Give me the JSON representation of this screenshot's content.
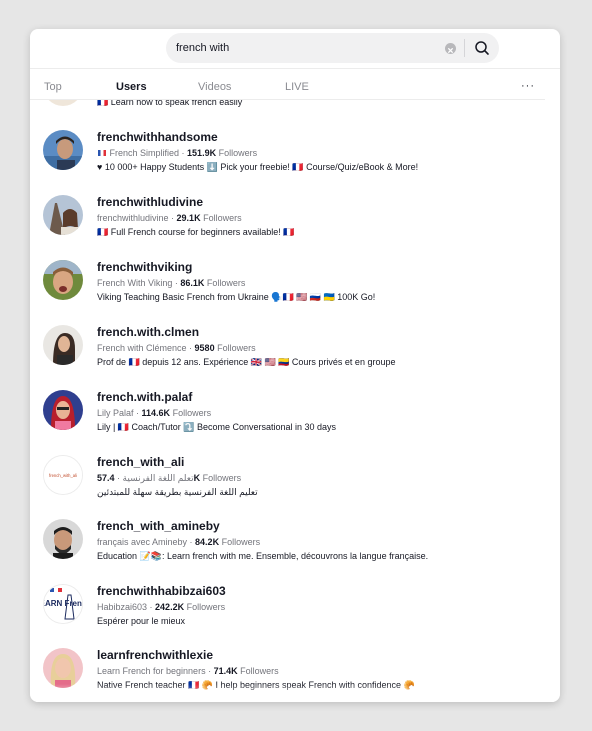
{
  "search": {
    "value": "french with"
  },
  "tabs": [
    {
      "label": "Top"
    },
    {
      "label": "Users"
    },
    {
      "label": "Videos"
    },
    {
      "label": "LIVE"
    }
  ],
  "more_label": "···",
  "cut_bio": "🇫🇷 Learn how to speak french easily",
  "users": [
    {
      "username": "frenchwithhandsome",
      "display_prefix": "🇫🇷",
      "display_name": "French Simplified",
      "followers": "151.9K",
      "followers_label": "Followers",
      "bio": "♥ 10 000+ Happy Students ⬇️ Pick your freebie! 🇫🇷 Course/Quiz/eBook & More!",
      "avatar_icon": "profile-photo"
    },
    {
      "username": "frenchwithludivine",
      "display_prefix": "",
      "display_name": "frenchwithludivine",
      "followers": "29.1K",
      "followers_label": "Followers",
      "bio": "🇫🇷 Full French course for beginners available! 🇫🇷",
      "avatar_icon": "profile-photo"
    },
    {
      "username": "frenchwithviking",
      "display_prefix": "",
      "display_name": "French With Viking",
      "followers": "86.1K",
      "followers_label": "Followers",
      "bio": "Viking Teaching Basic French from Ukraine 🗣️🇫🇷 🇺🇸 🇷🇺 🇺🇦 100K Go!",
      "avatar_icon": "profile-photo"
    },
    {
      "username": "french.with.clmen",
      "display_prefix": "",
      "display_name": "French with Clémence",
      "followers": "9580",
      "followers_label": "Followers",
      "bio": "Prof de 🇫🇷 depuis 12 ans. Expérience 🇬🇧 🇺🇸 🇨🇴 Cours privés et en groupe",
      "avatar_icon": "profile-photo"
    },
    {
      "username": "french.with.palaf",
      "display_prefix": "",
      "display_name": "Lily Palaf",
      "followers": "114.6K",
      "followers_label": "Followers",
      "bio": "Lily | 🇫🇷 Coach/Tutor ⤵️ Become Conversational in 30 days",
      "avatar_icon": "profile-photo"
    },
    {
      "username": "french_with_ali",
      "display_prefix": "",
      "display_name": "تعلم اللغة الفرنسية",
      "followers": "57.4K",
      "followers_label": "Followers",
      "bio": "تعليم اللغة الفرنسية بطريقة سهلة للمبتدئين",
      "avatar_icon": "logo-text"
    },
    {
      "username": "french_with_amineby",
      "display_prefix": "",
      "display_name": "français avec Amineby",
      "followers": "84.2K",
      "followers_label": "Followers",
      "bio": "Education 📝📚: Learn french with me. Ensemble, découvrons la langue française.",
      "avatar_icon": "profile-photo"
    },
    {
      "username": "frenchwithhabibzai603",
      "display_prefix": "",
      "display_name": "Habibzai603",
      "followers": "242.2K",
      "followers_label": "Followers",
      "bio": "Espérer pour le mieux",
      "avatar_icon": "learn-french-logo"
    },
    {
      "username": "learnfrenchwithlexie",
      "display_prefix": "",
      "display_name": "Learn French for beginners",
      "followers": "71.4K",
      "followers_label": "Followers",
      "bio": "Native French teacher 🇫🇷 🥐 I help beginners speak French with confidence 🥐",
      "avatar_icon": "profile-photo"
    }
  ],
  "avatar_logo_text": "french_with_ali",
  "avatar_learn_text": "LEARN French",
  "colors": {
    "background": "#e6e6e6",
    "panel": "#ffffff",
    "text_primary": "#161823",
    "text_secondary": "#73747b",
    "search_fill": "#f1f1f2"
  }
}
